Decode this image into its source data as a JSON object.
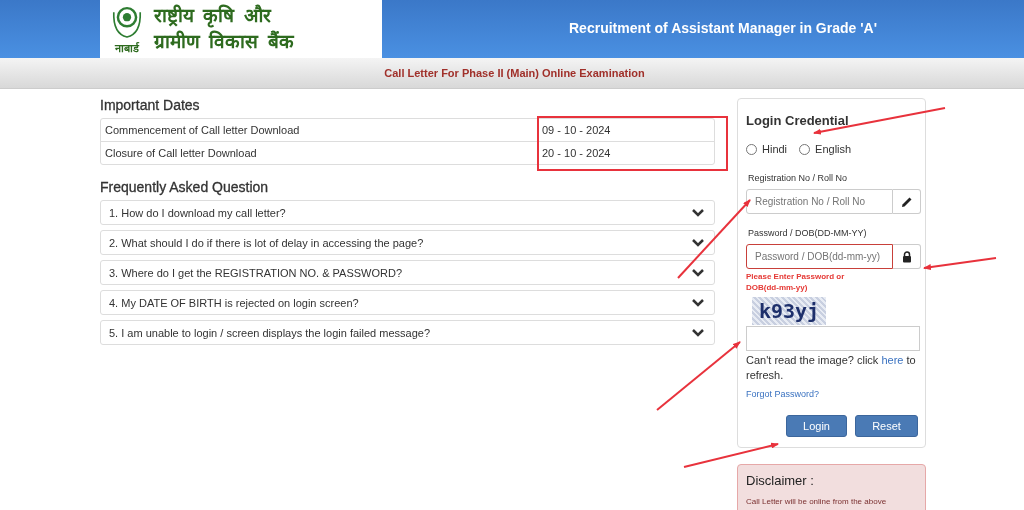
{
  "header": {
    "logo_caption": "नाबार्ड",
    "logo_lines": [
      "राष्ट्रीय कृषि और",
      "ग्रामीण विकास बैंक"
    ],
    "title": "Recruitment of Assistant Manager in Grade 'A'"
  },
  "subheader": {
    "title": "Call Letter For Phase II (Main) Online Examination"
  },
  "important_dates": {
    "heading": "Important Dates",
    "rows": [
      {
        "label": "Commencement of Call letter Download",
        "date": "09 - 10 - 2024"
      },
      {
        "label": "Closure of Call letter Download",
        "date": "20 - 10 - 2024"
      }
    ]
  },
  "faq": {
    "heading": "Frequently Asked Question",
    "items": [
      {
        "question": "1. How do I download my call letter?",
        "expanded": false
      },
      {
        "question": "2. What should I do if there is lot of delay in accessing the page?",
        "expanded": false
      },
      {
        "question": "3. Where do I get the REGISTRATION NO. & PASSWORD?",
        "expanded": false
      },
      {
        "question": "4. My DATE OF BIRTH is rejected on login screen?",
        "expanded": false
      },
      {
        "question": "5. I am unable to login / screen displays the login failed message?",
        "expanded": false
      }
    ]
  },
  "login": {
    "heading": "Login Credential",
    "languages": [
      {
        "label": "Hindi",
        "selected": false
      },
      {
        "label": "English",
        "selected": false
      }
    ],
    "fields": [
      {
        "label": "Registration No / Roll No",
        "placeholder": "Registration No / Roll No",
        "kind": "pencil",
        "invalid": false
      },
      {
        "label": "Password / DOB(DD-MM-YY)",
        "placeholder": "Password / DOB(dd-mm-yy)",
        "kind": "lock",
        "invalid": true,
        "error": "Please Enter Password or DOB(dd-mm-yy)"
      }
    ],
    "captcha": "k93yj",
    "refresh_text_before": "Can't read the image? click ",
    "refresh_link": "here",
    "refresh_text_after": " to refresh.",
    "forgot_link": "Forgot Password?",
    "buttons": [
      "Login",
      "Reset"
    ]
  },
  "disclaimer": {
    "heading": "Disclaimer :",
    "text": "Call Letter will be online from the above"
  }
}
